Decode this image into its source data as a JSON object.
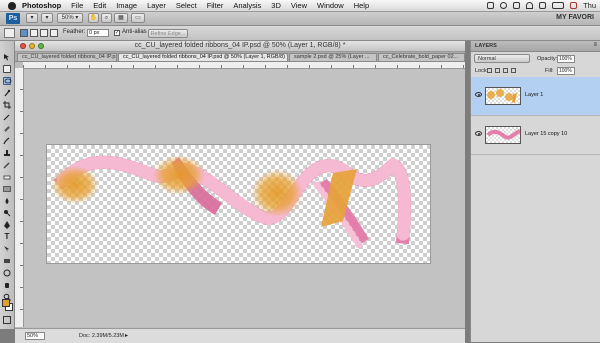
{
  "menubar": {
    "app_name": "Photoshop",
    "items": [
      "File",
      "Edit",
      "Image",
      "Layer",
      "Select",
      "Filter",
      "Analysis",
      "3D",
      "View",
      "Window",
      "Help"
    ],
    "clock": "Thu"
  },
  "appbar": {
    "logo": "Ps",
    "zoom": "50%",
    "workspace": "MY FAVORI"
  },
  "options": {
    "feather_label": "Feather:",
    "feather_value": "0 px",
    "antialias_label": "Anti-alias",
    "refine_edge_label": "Refine Edge..."
  },
  "document": {
    "title": "cc_CU_layered folded ribbons_04 IP.psd @ 50% (Layer 1, RGB/8) *",
    "tabs": [
      "cc_CU_layered folded ribbons_04 IP.psd",
      "cc_CU_layered folded ribbons_04 IP.psd @ 50% (Layer 1, RGB/8) *",
      "sample 2.psd @ 25% (Layer ...",
      "cc_Celebrate_bold_paper 02..."
    ],
    "zoom": "50%",
    "doc_info": "Doc: 2.39M/5.23M"
  },
  "layers_panel": {
    "title": "LAYERS",
    "blend_mode": "Normal",
    "opacity_label": "Opacity:",
    "opacity_value": "100%",
    "lock_label": "Lock:",
    "fill_label": "Fill:",
    "fill_value": "100%",
    "layers": [
      {
        "name": "Layer 1",
        "selected": true
      },
      {
        "name": "Layer 15 copy 10",
        "selected": false
      }
    ]
  },
  "colors": {
    "ribbon": "#e47fab",
    "highlight": "#e8a233",
    "selection": "#b3d0f2",
    "foreground": "#e0a030",
    "background": "#ffffff"
  }
}
